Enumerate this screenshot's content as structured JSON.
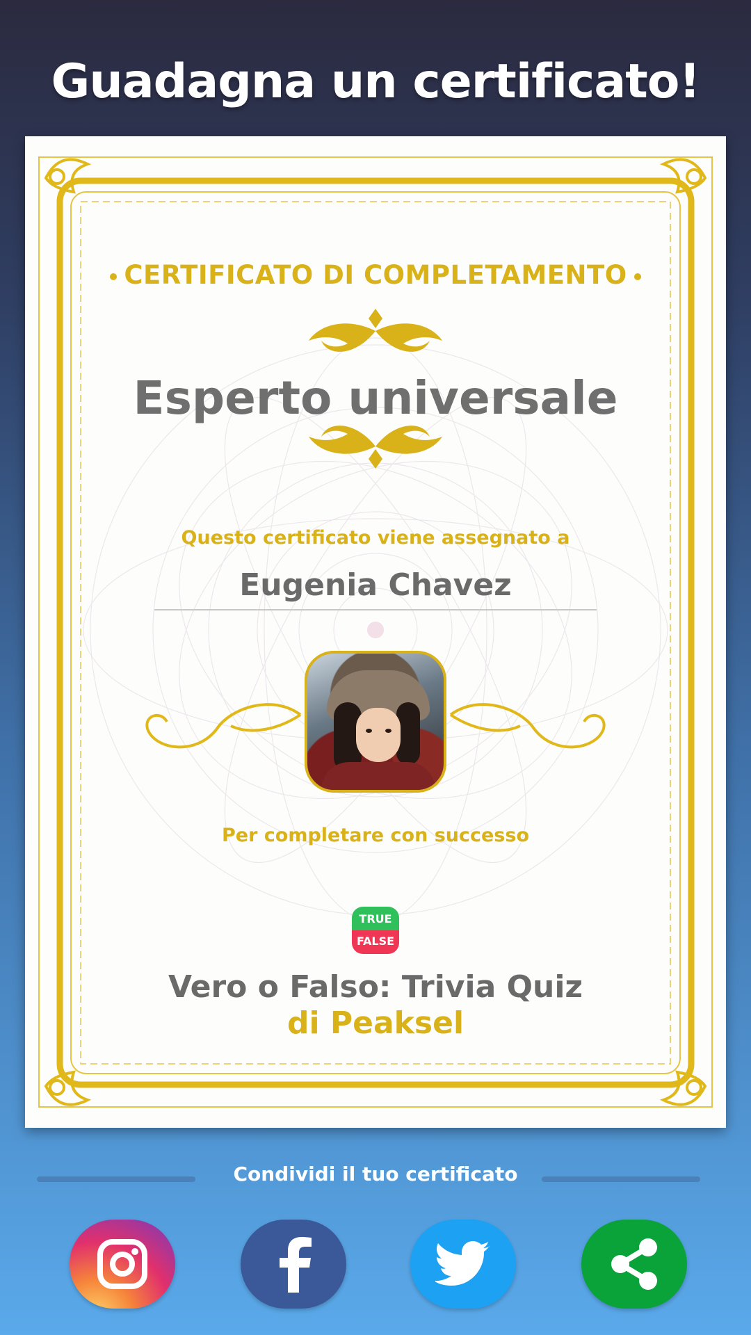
{
  "header": {
    "title": "Guadagna un certificato!"
  },
  "certificate": {
    "heading": "CERTIFICATO DI COMPLETAMENTO",
    "title": "Esperto universale",
    "awarded_to_label": "Questo certificato viene assegnato a",
    "recipient_name": "Eugenia Chavez",
    "completion_label": "Per completare con successo",
    "app_icon": {
      "top": "TRUE",
      "bottom": "FALSE"
    },
    "app_name": "Vero o Falso: Trivia Quiz",
    "publisher": "di Peaksel"
  },
  "share": {
    "label": "Condividi il tuo certificato",
    "buttons": [
      {
        "name": "instagram",
        "icon": "instagram-icon",
        "color": "#e1306c"
      },
      {
        "name": "facebook",
        "icon": "facebook-icon",
        "color": "#3b5998"
      },
      {
        "name": "twitter",
        "icon": "twitter-icon",
        "color": "#1da1f2"
      },
      {
        "name": "share",
        "icon": "share-icon",
        "color": "#0aa33a"
      }
    ]
  },
  "colors": {
    "gold": "#d9b21a",
    "text_gray": "#6f6f6f",
    "background_top": "#2b2a3f",
    "background_bottom": "#5aa9ea"
  }
}
